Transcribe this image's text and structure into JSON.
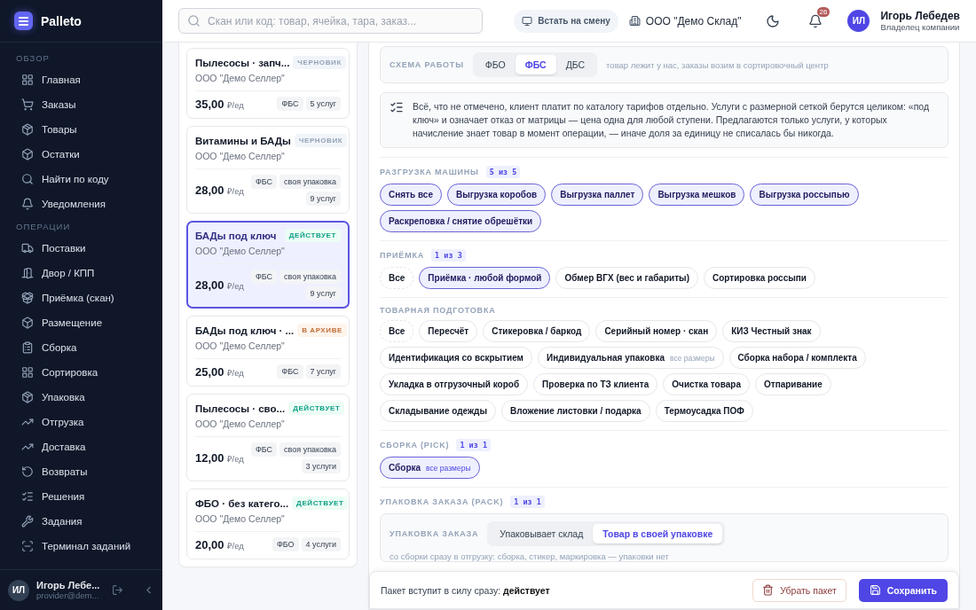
{
  "sidebar": {
    "logo": "Palleto",
    "groups": [
      {
        "label": "ОБЗОР",
        "items": [
          {
            "label": "Главная",
            "selected": false
          },
          {
            "label": "Заказы",
            "selected": false
          },
          {
            "label": "Товары",
            "selected": false
          },
          {
            "label": "Остатки",
            "selected": false
          },
          {
            "label": "Найти по коду",
            "selected": false
          },
          {
            "label": "Уведомления",
            "selected": false
          }
        ]
      },
      {
        "label": "ОПЕРАЦИИ",
        "items": [
          {
            "label": "Поставки",
            "selected": false
          },
          {
            "label": "Двор / КПП",
            "selected": false
          },
          {
            "label": "Приёмка (скан)",
            "selected": false
          },
          {
            "label": "Размещение",
            "selected": false
          },
          {
            "label": "Сборка",
            "selected": false
          },
          {
            "label": "Сортировка",
            "selected": false
          },
          {
            "label": "Упаковка",
            "selected": false
          },
          {
            "label": "Отгрузка",
            "selected": false
          },
          {
            "label": "Доставка",
            "selected": false
          },
          {
            "label": "Возвраты",
            "selected": false
          },
          {
            "label": "Решения",
            "selected": false
          },
          {
            "label": "Задания",
            "selected": false
          },
          {
            "label": "Терминал заданий",
            "selected": false
          }
        ]
      }
    ],
    "user": {
      "initials": "ИЛ",
      "name": "Игорь Лебе...",
      "email": "provider@dem..."
    }
  },
  "header": {
    "search": {
      "placeholder": "Скан или код: товар, ячейка, тара, заказ..."
    },
    "shift_button": "Встать на смену",
    "org": "ООО \"Демо Склад\"",
    "notifications": "26",
    "user": {
      "initials": "ИЛ",
      "name": "Игорь Лебедев",
      "role": "Владелец компании"
    }
  },
  "packages": [
    {
      "title": "Пылесосы · запч...",
      "seller": "ООО \"Демо Селлер\"",
      "status": {
        "label": "ЧЕРНОВИК",
        "kind": "draft"
      },
      "price": "35,00",
      "unit": "₽/ед",
      "tags": [
        "ФБС",
        "5 услуг"
      ],
      "selected": false
    },
    {
      "title": "Витамины и БАДы",
      "seller": "ООО \"Демо Селлер\"",
      "status": {
        "label": "ЧЕРНОВИК",
        "kind": "draft"
      },
      "price": "28,00",
      "unit": "₽/ед",
      "tags": [
        "ФБС",
        "своя упаковка",
        "9 услуг"
      ],
      "selected": false
    },
    {
      "title": "БАДы под ключ",
      "seller": "ООО \"Демо Селлер\"",
      "status": {
        "label": "ДЕЙСТВУЕТ",
        "kind": "active"
      },
      "price": "28,00",
      "unit": "₽/ед",
      "tags": [
        "ФБС",
        "своя упаковка",
        "9 услуг"
      ],
      "selected": true
    },
    {
      "title": "БАДы под ключ · ...",
      "seller": "ООО \"Демо Селлер\"",
      "status": {
        "label": "В АРХИВЕ",
        "kind": "archived"
      },
      "price": "25,00",
      "unit": "₽/ед",
      "tags": [
        "ФБС",
        "7 услуг"
      ],
      "selected": false
    },
    {
      "title": "Пылесосы · сво...",
      "seller": "ООО \"Демо Селлер\"",
      "status": {
        "label": "ДЕЙСТВУЕТ",
        "kind": "active"
      },
      "price": "12,00",
      "unit": "₽/ед",
      "tags": [
        "ФБС",
        "своя упаковка",
        "3 услуги"
      ],
      "selected": false
    },
    {
      "title": "ФБО · без катего...",
      "seller": "ООО \"Демо Селлер\"",
      "status": {
        "label": "ДЕЙСТВУЕТ",
        "kind": "active"
      },
      "price": "20,00",
      "unit": "₽/ед",
      "tags": [
        "ФБО",
        "4 услуги"
      ],
      "selected": false
    }
  ],
  "scheme": {
    "label": "СХЕМА РАБОТЫ",
    "options": [
      {
        "label": "ФБО",
        "selected": false
      },
      {
        "label": "ФБС",
        "selected": true
      },
      {
        "label": "ДБС",
        "selected": false
      }
    ],
    "hint": "товар лежит у нас, заказы возим в сортировочный центр"
  },
  "info": "Всё, что не отмечено, клиент платит по каталогу тарифов отдельно. Услуги с размерной сеткой берутся целиком: «под ключ» и означает отказ от матрицы — цена одна для любой ступени. Предлагаются только услуги, у которых начисление знает товар в момент операции, — иначе доля за единицу не списалась бы никогда.",
  "sections": [
    {
      "title": "РАЗГРУЗКА МАШИНЫ",
      "count": "5 из 5",
      "chips": [
        {
          "label": "Снять все",
          "kind": "all",
          "selected": true
        },
        {
          "label": "Выгрузка коробов",
          "kind": "service",
          "selected": true
        },
        {
          "label": "Выгрузка паллет",
          "kind": "service",
          "selected": true
        },
        {
          "label": "Выгрузка мешков",
          "kind": "service",
          "selected": true
        },
        {
          "label": "Выгрузка россыпью",
          "kind": "service",
          "selected": true
        },
        {
          "label": "Раскреповка / снятие обрешётки",
          "kind": "service",
          "selected": true
        }
      ]
    },
    {
      "title": "ПРИЁМКА",
      "count": "1 из 3",
      "chips": [
        {
          "label": "Все",
          "kind": "all",
          "selected": false
        },
        {
          "label": "Приёмка · любой формой",
          "kind": "service",
          "selected": true
        },
        {
          "label": "Обмер ВГХ (вес и габариты)",
          "kind": "service",
          "selected": false
        },
        {
          "label": "Сортировка россыпи",
          "kind": "service",
          "selected": false
        }
      ]
    },
    {
      "title": "ТОВАРНАЯ ПОДГОТОВКА",
      "chips": [
        {
          "label": "Все",
          "kind": "all",
          "selected": false
        },
        {
          "label": "Пересчёт",
          "kind": "service",
          "selected": false
        },
        {
          "label": "Стикеровка / баркод",
          "kind": "service",
          "selected": false
        },
        {
          "label": "Серийный номер · скан",
          "kind": "service",
          "selected": false
        },
        {
          "label": "КИЗ Честный знак",
          "kind": "service",
          "selected": false
        },
        {
          "label": "Идентификация со вскрытием",
          "kind": "service",
          "selected": false
        },
        {
          "label": "Индивидуальная упаковка",
          "note": "все размеры",
          "kind": "service",
          "selected": false
        },
        {
          "label": "Сборка набора / комплекта",
          "kind": "service",
          "selected": false
        },
        {
          "label": "Укладка в отгрузочный короб",
          "kind": "service",
          "selected": false
        },
        {
          "label": "Проверка по ТЗ клиента",
          "kind": "service",
          "selected": false
        },
        {
          "label": "Очистка товара",
          "kind": "service",
          "selected": false
        },
        {
          "label": "Отпаривание",
          "kind": "service",
          "selected": false
        },
        {
          "label": "Складывание одежды",
          "kind": "service",
          "selected": false
        },
        {
          "label": "Вложение листовки / подарка",
          "kind": "service",
          "selected": false
        },
        {
          "label": "Термоусадка ПОФ",
          "kind": "service",
          "selected": false
        }
      ]
    },
    {
      "title": "СБОРКА (PICK)",
      "count": "1 из 1",
      "chips": [
        {
          "label": "Сборка",
          "note": "все размеры",
          "kind": "service",
          "selected": true
        }
      ]
    }
  ],
  "pack": {
    "title": "УПАКОВКА ЗАКАЗА (PACK)",
    "count": "1 из 1",
    "label": "УПАКОВКА ЗАКАЗА",
    "options": [
      {
        "label": "Упаковывает склад",
        "selected": false
      },
      {
        "label": "Товар в своей упаковке",
        "selected": true
      }
    ],
    "hint": "со сборки сразу в отгрузку: сборка, стикер, маркировка — упаковки нет"
  },
  "footer": {
    "text": "Пакет вступит в силу сразу: **действует**",
    "remove": "Убрать пакет",
    "save": "Сохранить"
  }
}
